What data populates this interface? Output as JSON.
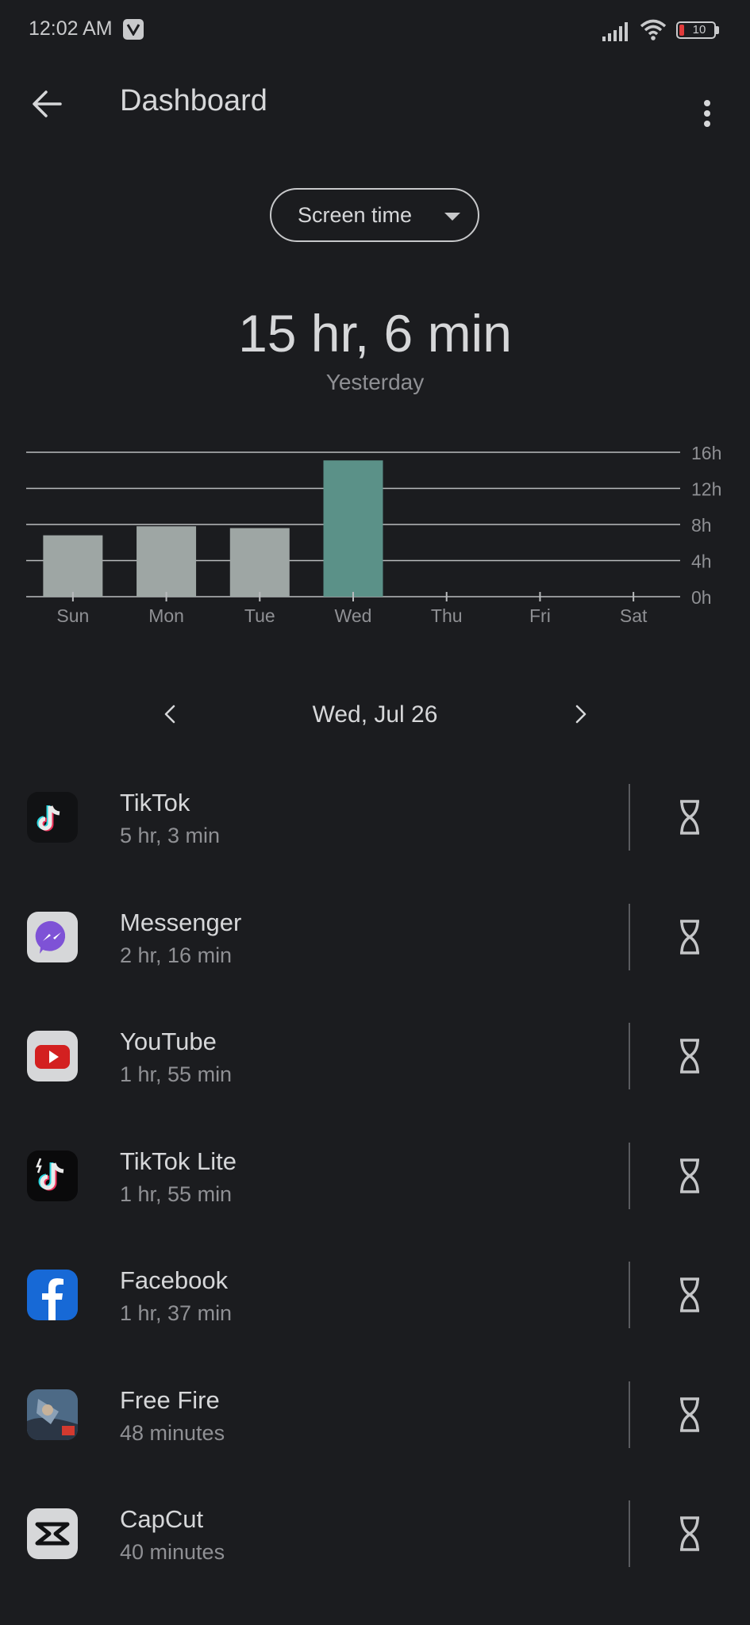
{
  "status_bar": {
    "time": "12:02 AM",
    "battery": "10"
  },
  "header": {
    "title": "Dashboard"
  },
  "selector": {
    "label": "Screen time"
  },
  "summary": {
    "total": "15 hr, 6 min",
    "caption": "Yesterday"
  },
  "chart_data": {
    "type": "bar",
    "categories": [
      "Sun",
      "Mon",
      "Tue",
      "Wed",
      "Thu",
      "Fri",
      "Sat"
    ],
    "values": [
      6.8,
      7.8,
      7.6,
      15.1,
      0,
      0,
      0
    ],
    "highlight_index": 3,
    "y_ticks": [
      "0h",
      "4h",
      "8h",
      "12h",
      "16h"
    ],
    "ylim": [
      0,
      16
    ],
    "colors": {
      "bar": "#9ea6a4",
      "highlight": "#5b9188",
      "grid": "#b9bbbd",
      "axis_text": "#8f9094"
    }
  },
  "date_nav": {
    "label": "Wed, Jul 26"
  },
  "apps": [
    {
      "name": "TikTok",
      "time": "5 hr, 3 min",
      "icon": "tiktok-icon"
    },
    {
      "name": "Messenger",
      "time": "2 hr, 16 min",
      "icon": "messenger-icon"
    },
    {
      "name": "YouTube",
      "time": "1 hr, 55 min",
      "icon": "youtube-icon"
    },
    {
      "name": "TikTok Lite",
      "time": "1 hr, 55 min",
      "icon": "tiktok-lite-icon"
    },
    {
      "name": "Facebook",
      "time": "1 hr, 37 min",
      "icon": "facebook-icon"
    },
    {
      "name": "Free Fire",
      "time": "48 minutes",
      "icon": "free-fire-icon"
    },
    {
      "name": "CapCut",
      "time": "40 minutes",
      "icon": "capcut-icon"
    }
  ]
}
